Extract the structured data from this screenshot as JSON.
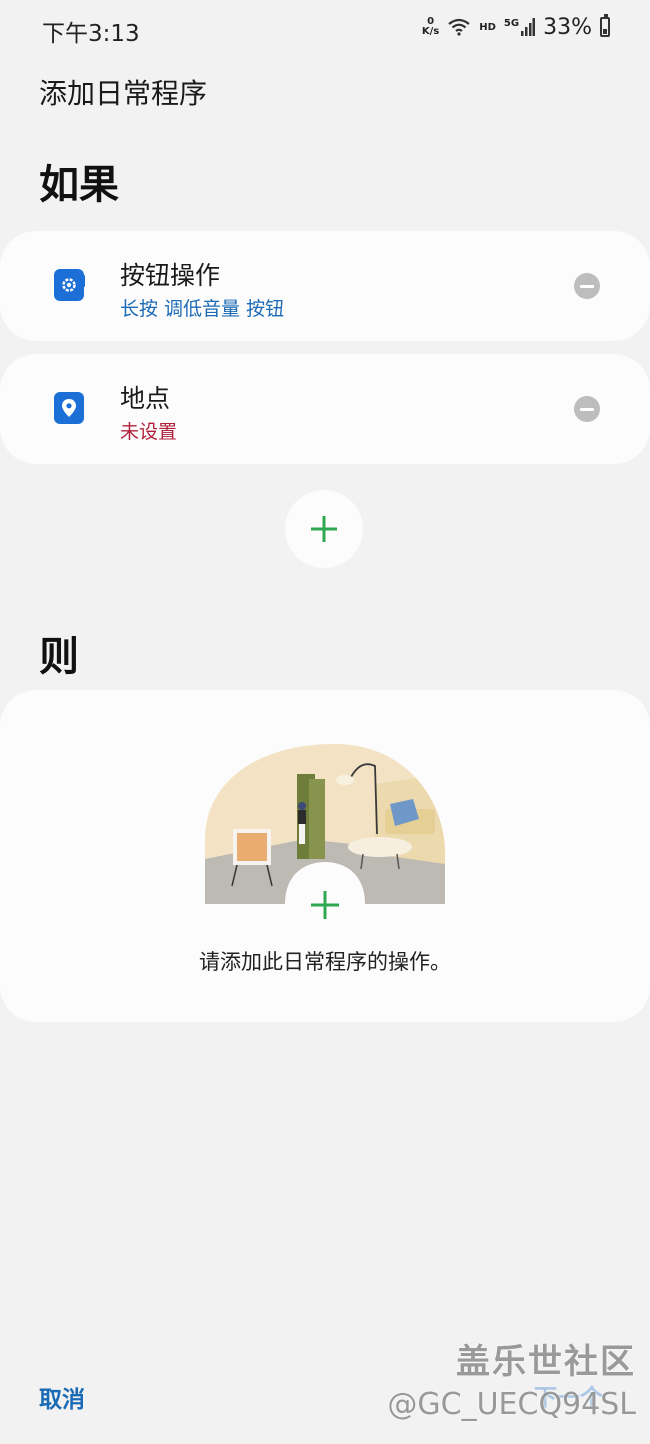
{
  "status_bar": {
    "time": "下午3:13",
    "net_speed_value": "0",
    "net_speed_unit": "K/s",
    "hd": "HD",
    "network": "5G",
    "battery": "33%",
    "icons": [
      "wifi-icon",
      "signal-icon",
      "battery-icon"
    ]
  },
  "page": {
    "title": "添加日常程序"
  },
  "if_section": {
    "heading": "如果",
    "conditions": [
      {
        "icon": "button-action-icon",
        "title": "按钮操作",
        "subtitle": "长按 调低音量 按钮",
        "subtitle_color": "#1b6ab5"
      },
      {
        "icon": "location-pin-icon",
        "title": "地点",
        "subtitle": "未设置",
        "subtitle_color": "#b0203a"
      }
    ],
    "add_icon": "plus-icon"
  },
  "then_section": {
    "heading": "则",
    "hint": "请添加此日常程序的操作。",
    "add_icon": "plus-icon"
  },
  "footer": {
    "cancel": "取消",
    "next": "下一个"
  },
  "watermark": {
    "line1": "盖乐世社区",
    "line2": "@GC_UECQ94SL"
  },
  "colors": {
    "accent": "#1b6ab5",
    "plus_green": "#2fa84f",
    "icon_blue": "#1d6fd8",
    "error_red": "#b0203a",
    "background": "#f2f2f2",
    "card": "#fcfcfc"
  }
}
